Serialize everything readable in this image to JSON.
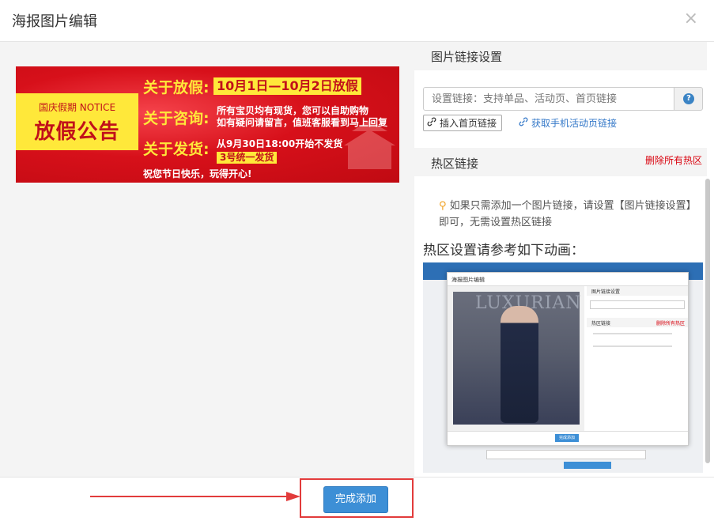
{
  "modal": {
    "title": "海报图片编辑",
    "close_symbol": "×"
  },
  "poster": {
    "notice_top": "国庆假期 NOTICE",
    "notice_big": "放假公告",
    "line1_title": "关于放假:",
    "line1_box": "10月1日—10月2日放假",
    "line2_title": "关于咨询:",
    "line2_text_a": "所有宝贝均有现货，您可以自助购物",
    "line2_text_b": "如有疑问请留言，值班客服看到马上回复",
    "line3_title": "关于发货:",
    "line3_text": "从9月30日18:00开始不发货",
    "line3_box": "3号统一发货",
    "footer": "祝您节日快乐，玩得开心!"
  },
  "link_settings": {
    "heading": "图片链接设置",
    "input_placeholder": "设置链接：支持单品、活动页、首页链接",
    "help_symbol": "?",
    "insert_home_label": "插入首页链接",
    "mobile_link_label": "获取手机活动页链接"
  },
  "hotspot": {
    "heading": "热区链接",
    "delete_all_label": "删除所有热区",
    "tip": "如果只需添加一个图片链接，请设置【图片链接设置】即可，无需设置热区链接",
    "anim_title": "热区设置请参考如下动画："
  },
  "animation_preview": {
    "dialog_title": "海报图片编辑",
    "panel_heading": "图片链接设置",
    "hotspot_heading": "热区链接",
    "delete_label": "删除所有热区",
    "button_label": "完成添加",
    "poster_text": "LUXURIAN"
  },
  "footer": {
    "done_label": "完成添加"
  },
  "colors": {
    "accent": "#3d8fd6",
    "danger": "#d9000c",
    "annotation": "#e23b3b",
    "poster_red": "#d7101a",
    "poster_yellow": "#ffe83a"
  }
}
